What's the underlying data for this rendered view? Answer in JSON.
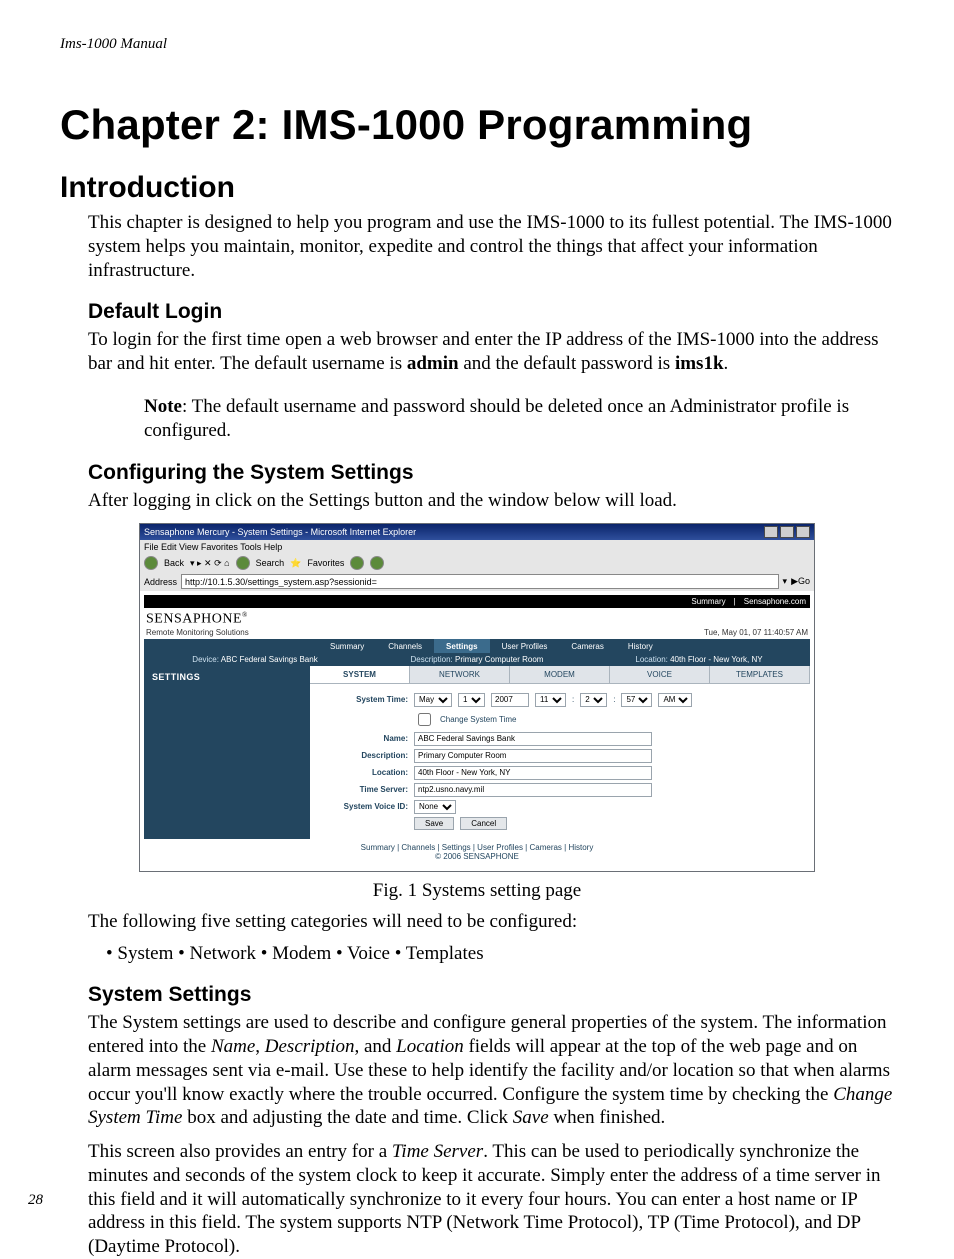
{
  "running_head": "Ims-1000 Manual",
  "page_number": "28",
  "chapter_title": "Chapter 2: IMS-1000 Programming",
  "section_intro": "Introduction",
  "intro_para": "This chapter is designed to help you program and use the IMS-1000 to its fullest potential. The IMS-1000 system helps you maintain, monitor, expedite and control the things that affect your information infrastructure.",
  "h_default_login": "Default Login",
  "p_login_1": "To login for the first time open a web browser and enter the IP address of the IMS-1000 into the address bar and hit enter. The default username is ",
  "p_login_admin": "admin",
  "p_login_2": " and the default password is ",
  "p_login_pass": "ims1k",
  "p_login_3": ".",
  "note_label": "Note",
  "note_text": ": The default username and password should be deleted once an Administrator profile is configured.",
  "h_config": "Configuring the System Settings",
  "p_config": "After logging in click on the Settings button and the window below will load.",
  "figure_caption": "Fig. 1 Systems setting page",
  "p_five": "The following five setting categories will need to be configured:",
  "bullets": "• System • Network • Modem • Voice • Templates",
  "h_syssettings": "System Settings",
  "p_sys_1a": "The System settings are used to describe and configure general properties of the system. The infor­mation entered into the ",
  "p_sys_name": "Name",
  "p_sys_1b": ", ",
  "p_sys_desc": "Description",
  "p_sys_1c": ", and ",
  "p_sys_loc": "Location",
  "p_sys_1d": " fields will appear at the top of the web page and on alarm messages sent via e-mail. Use these to help identify the facility and/or location so that when alarms occur you'll know exactly where the trouble occurred. Configure the system time by checking the ",
  "p_sys_cst": "Change System Time",
  "p_sys_1e": " box and adjusting the date and time. Click ",
  "p_sys_save": "Save",
  "p_sys_1f": " when finished.",
  "p_sys_2a": "This screen also provides an entry for a ",
  "p_sys_ts": "Time Server",
  "p_sys_2b": ". This can be used to periodically synchronize the minutes and seconds of the system clock to keep it accurate. Simply enter the address of a time server in this field and it will automatically synchronize to it every four hours. You can enter a host name or IP address in this field. The system supports NTP (Network Time Protocol), TP (Time Protocol), and DP (Daytime Protocol).",
  "screenshot": {
    "ie_title": "Sensaphone Mercury - System Settings - Microsoft Internet Explorer",
    "ie_menu": "File   Edit   View   Favorites   Tools   Help",
    "ie_back": "Back",
    "ie_search": "Search",
    "ie_fav": "Favorites",
    "addr_label": "Address",
    "addr_value": "http://10.1.5.30/settings_system.asp?sessionid=",
    "go": "Go",
    "top_summary": "Summary",
    "top_link": "Sensaphone.com",
    "brand": "SENSAPHONE",
    "brand_reg": "®",
    "brand_sub": "Remote Monitoring Solutions",
    "date": "Tue, May 01, 07 11:40:57 AM",
    "tabs": [
      "Summary",
      "Channels",
      "Settings",
      "User Profiles",
      "Cameras",
      "History"
    ],
    "info_device_label": "Device:",
    "info_device": "ABC Federal Savings Bank",
    "info_desc_label": "Description:",
    "info_desc": "Primary Computer Room",
    "info_loc_label": "Location:",
    "info_loc": "40th Floor - New York, NY",
    "side": "SETTINGS",
    "stabs": [
      "SYSTEM",
      "NETWORK",
      "MODEM",
      "VOICE",
      "TEMPLATES"
    ],
    "form": {
      "systime_label": "System Time:",
      "month": "May",
      "day": "1",
      "year": "2007",
      "hh": "11",
      "mm": "2",
      "ss": "57",
      "ampm": "AM",
      "change_label": "Change System Time",
      "name_label": "Name:",
      "name_val": "ABC Federal Savings Bank",
      "desc_label": "Description:",
      "desc_val": "Primary Computer Room",
      "loc_label": "Location:",
      "loc_val": "40th Floor - New York, NY",
      "ts_label": "Time Server:",
      "ts_val": "ntp2.usno.navy.mil",
      "voice_label": "System Voice ID:",
      "voice_val": "None",
      "save": "Save",
      "cancel": "Cancel"
    },
    "footer1": "Summary | Channels | Settings | User Profiles | Cameras | History",
    "footer2": "© 2006 SENSAPHONE"
  }
}
